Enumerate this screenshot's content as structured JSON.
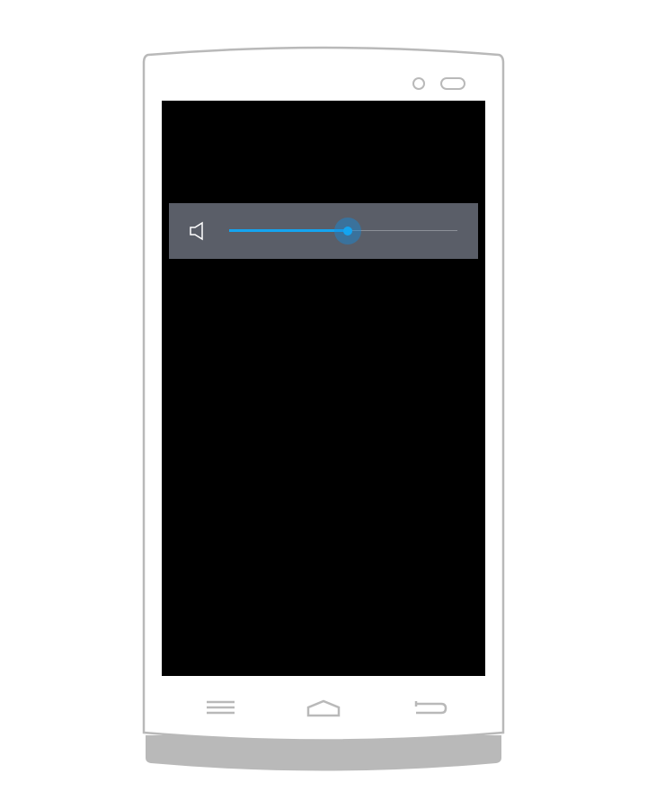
{
  "device": {
    "frame_color": "#b9b9b9",
    "screen_color": "#000000"
  },
  "volume_dialog": {
    "icon": "speaker-icon",
    "slider_value": 0.52,
    "accent_color": "#14a4f0",
    "panel_color": "#5a5e68"
  },
  "nav_bar": {
    "icons": [
      "menu-icon",
      "home-icon",
      "back-icon"
    ]
  }
}
